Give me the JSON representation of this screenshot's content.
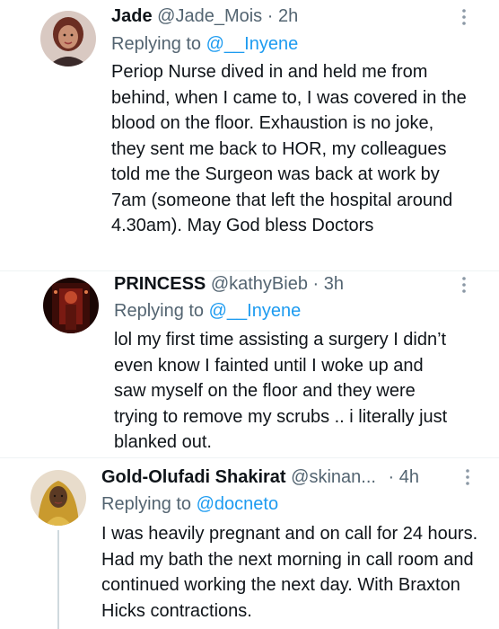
{
  "colors": {
    "link": "#1d9bf0",
    "secondary_text": "#536471",
    "primary_text": "#0f1419",
    "thread_line": "#cfd9de"
  },
  "tweets": [
    {
      "name": "Jade",
      "handle": "@Jade_Mois",
      "separator": "·",
      "time": "2h",
      "reply_prefix": "Replying to",
      "reply_to": "@__Inyene",
      "text": "Periop Nurse dived in and held me from behind, when I came to, I was covered in the blood on the floor. Exhaustion is no joke, they sent me back to HOR, my colleagues told me the Surgeon was back at work by 7am (someone that left the hospital around 4.30am). May God bless Doctors",
      "more_icon": "more-vertical-icon"
    },
    {
      "name": "PRINCESS",
      "handle": "@kathyBieb",
      "separator": "·",
      "time": "3h",
      "reply_prefix": "Replying to",
      "reply_to": "@__Inyene",
      "text": "lol my first time assisting a surgery I didn’t even know I fainted until I woke up and saw myself on the floor and they were trying to remove my scrubs .. i literally just blanked out.",
      "more_icon": "more-vertical-icon"
    },
    {
      "name": "Gold-Olufadi Shakirat",
      "handle": "@skinan...",
      "separator": "·",
      "time": "4h",
      "reply_prefix": "Replying to",
      "reply_to": "@docneto",
      "text": "I was heavily pregnant and on call for 24 hours. Had my bath the next morning in call room and continued working the next day. With Braxton Hicks contractions.",
      "more_icon": "more-vertical-icon"
    }
  ]
}
